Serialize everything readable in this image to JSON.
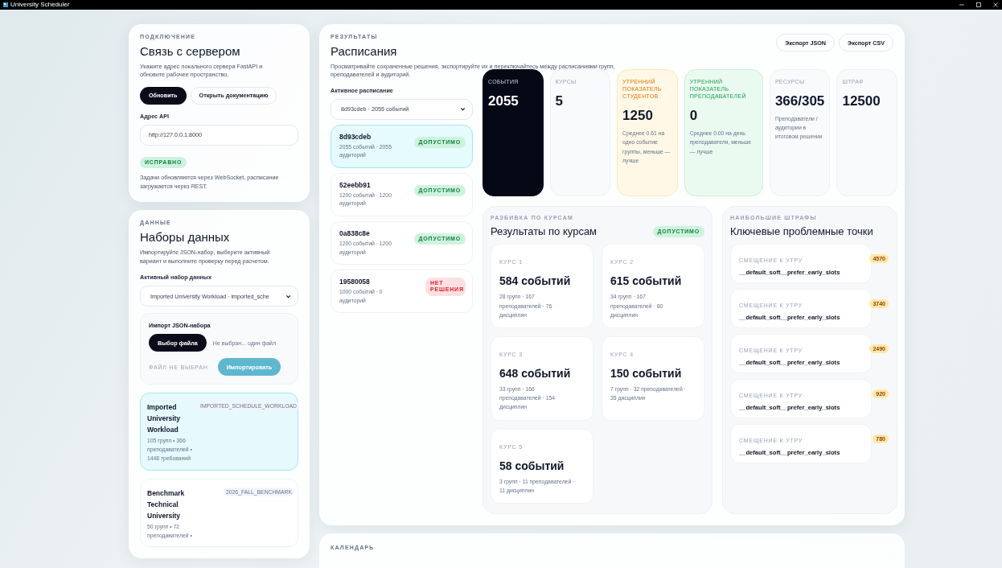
{
  "window": {
    "title": "University Scheduler"
  },
  "connection": {
    "eyebrow": "ПОДКЛЮЧЕНИЕ",
    "title": "Связь с сервером",
    "description": "Укажите адрес локального сервера FastAPI и обновите рабочее пространство.",
    "buttons": [
      {
        "label": "Обновить",
        "kind": "primary"
      },
      {
        "label": "Открыть документацию",
        "kind": "secondary"
      }
    ],
    "api_label": "Адрес API",
    "api_value": "http://127.0.0.1:8000",
    "status": {
      "label": "ИСПРАВНО",
      "kind": "ok"
    },
    "note": "Задачи обновляются через WebSocket, расписание загружается через REST."
  },
  "datasets": {
    "eyebrow": "ДАННЫЕ",
    "title": "Наборы данных",
    "description": "Импортируйте JSON-набор, выберите активный вариант и выполните проверку перед расчетом.",
    "select_label": "Активный набор данных",
    "select_value": "Imported University Workload · imported_sche",
    "import": {
      "title": "Импорт JSON-набора",
      "file_button": "Выбор файла",
      "file_text": "Не выбран... один файл",
      "status": "ФАЙЛ НЕ ВЫБРАН",
      "submit": "Импортировать"
    },
    "items": [
      {
        "name": "Imported University Workload",
        "tag": "IMPORTED_SCHEDULE_WORKLOAD",
        "meta": "105 групп • 366 преподавателей • 1448 требований",
        "selected": true
      },
      {
        "name": "Benchmark Technical University",
        "tag": "2026_FALL_BENCHMARK",
        "meta": "50 групп • 72 преподавателей •",
        "selected": false
      }
    ]
  },
  "results": {
    "eyebrow": "РЕЗУЛЬТАТЫ",
    "title": "Расписания",
    "description": "Просматривайте сохраненные решения, экспортируйте их и переключайтесь между расписаниями групп, преподавателей и аудиторий.",
    "exports": [
      "Экспорт JSON",
      "Экспорт CSV"
    ],
    "select_label": "Активное расписание",
    "select_value": "8d93cdeb · 2055 событий",
    "schedules": [
      {
        "id": "8d93cdeb",
        "meta": "2055 событий · 2055 аудиторий",
        "status": {
          "label": "ДОПУСТИМО",
          "kind": "ok"
        },
        "selected": true
      },
      {
        "id": "52eebb91",
        "meta": "1200 событий · 1200 аудиторий",
        "status": {
          "label": "ДОПУСТИМО",
          "kind": "ok"
        },
        "selected": false
      },
      {
        "id": "0a838c8e",
        "meta": "1200 событий · 1200 аудиторий",
        "status": {
          "label": "ДОПУСТИМО",
          "kind": "ok"
        },
        "selected": false
      },
      {
        "id": "19580058",
        "meta": "1000 событий · 0 аудиторий",
        "status": {
          "label": "НЕТ РЕШЕНИЯ",
          "kind": "bad"
        },
        "selected": false
      }
    ],
    "stats": [
      {
        "label": "СОБЫТИЯ",
        "value": "2055",
        "kind": "dark"
      },
      {
        "label": "КУРСЫ",
        "value": "5",
        "kind": "plain"
      },
      {
        "label": "УТРЕННИЙ ПОКАЗАТЕЛЬ СТУДЕНТОВ",
        "value": "1250",
        "note": "Среднее 0.61 на одно событие группы, меньше — лучше",
        "kind": "amber"
      },
      {
        "label": "УТРЕННИЙ ПОКАЗАТЕЛЬ ПРЕПОДАВАТЕЛЕЙ",
        "value": "0",
        "note": "Среднее 0.00 на день преподавателя, меньше — лучше",
        "kind": "green"
      },
      {
        "label": "РЕСУРСЫ",
        "value": "366/305",
        "note": "Преподаватели / аудитории в итоговом решении",
        "kind": "plain"
      },
      {
        "label": "ШТРАФ",
        "value": "12500",
        "kind": "plain"
      }
    ],
    "courses": {
      "eyebrow": "РАЗБИВКА ПО КУРСАМ",
      "title": "Результаты по курсам",
      "status": {
        "label": "ДОПУСТИМО",
        "kind": "ok"
      },
      "items": [
        {
          "label": "КУРС 1",
          "value": "584 событий",
          "meta": "28 групп · 167 преподавателей · 76 дисциплин"
        },
        {
          "label": "КУРС 2",
          "value": "615 событий",
          "meta": "34 групп · 167 преподавателей · 80 дисциплин"
        },
        {
          "label": "КУРС 3",
          "value": "648 событий",
          "meta": "33 групп · 166 преподавателей · 154 дисциплин"
        },
        {
          "label": "КУРС 4",
          "value": "150 событий",
          "meta": "7 групп · 32 преподавателей · 35 дисциплин"
        },
        {
          "label": "КУРС 5",
          "value": "58 событий",
          "meta": "3 групп · 11 преподавателей · 11 дисциплин"
        }
      ]
    },
    "penalties": {
      "eyebrow": "НАИБОЛЬШИЕ ШТРАФЫ",
      "title": "Ключевые проблемные точки",
      "items": [
        {
          "label": "СМЕЩЕНИЕ К УТРУ",
          "name": "__default_soft__prefer_early_slots",
          "value": "4570"
        },
        {
          "label": "СМЕЩЕНИЕ К УТРУ",
          "name": "__default_soft__prefer_early_slots",
          "value": "3740"
        },
        {
          "label": "СМЕЩЕНИЕ К УТРУ",
          "name": "__default_soft__prefer_early_slots",
          "value": "2490"
        },
        {
          "label": "СМЕЩЕНИЕ К УТРУ",
          "name": "__default_soft__prefer_early_slots",
          "value": "920"
        },
        {
          "label": "СМЕЩЕНИЕ К УТРУ",
          "name": "__default_soft__prefer_early_slots",
          "value": "780"
        }
      ]
    }
  },
  "calendar": {
    "eyebrow": "КАЛЕНДАРЬ"
  }
}
